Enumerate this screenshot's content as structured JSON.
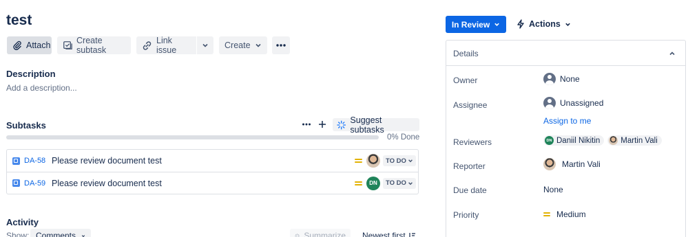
{
  "issue": {
    "title": "test"
  },
  "toolbar": {
    "attach": "Attach",
    "create_subtask": "Create subtask",
    "link_issue": "Link issue",
    "create": "Create"
  },
  "description": {
    "heading": "Description",
    "placeholder": "Add a description..."
  },
  "subtasks": {
    "heading": "Subtasks",
    "suggest_label": "Suggest subtasks",
    "progress_text": "0% Done",
    "progress_fraction": 0,
    "items": [
      {
        "key": "DA-58",
        "summary": "Please review document test",
        "status": "TO DO",
        "assignee_initials": ""
      },
      {
        "key": "DA-59",
        "summary": "Please review document test",
        "status": "TO DO",
        "assignee_initials": "DN"
      }
    ]
  },
  "activity": {
    "heading": "Activity",
    "show_label": "Show:",
    "filter_value": "Comments",
    "summarize_label": "Summarize",
    "sort_label": "Newest first"
  },
  "sidebar": {
    "status_button": "In Review",
    "actions_label": "Actions",
    "details_heading": "Details",
    "fields": {
      "owner": {
        "label": "Owner",
        "value": "None"
      },
      "assignee": {
        "label": "Assignee",
        "value": "Unassigned",
        "assign_link": "Assign to me"
      },
      "reviewers": {
        "label": "Reviewers",
        "values": [
          {
            "name": "Daniil Nikitin",
            "initials": "DN"
          },
          {
            "name": "Martin Vali"
          }
        ]
      },
      "reporter": {
        "label": "Reporter",
        "value": "Martin Vali"
      },
      "due_date": {
        "label": "Due date",
        "value": "None"
      },
      "priority": {
        "label": "Priority",
        "value": "Medium"
      }
    }
  },
  "colors": {
    "primary": "#0c66e4",
    "medium_priority": "#e2b203",
    "dn_avatar": "#1f845a"
  },
  "icons": [
    "paperclip-icon",
    "subtask-icon",
    "link-icon",
    "chevron-down-icon",
    "more-icon",
    "plus-icon",
    "sparkle-icon",
    "lightning-icon",
    "chevron-up-icon",
    "sort-icon"
  ]
}
